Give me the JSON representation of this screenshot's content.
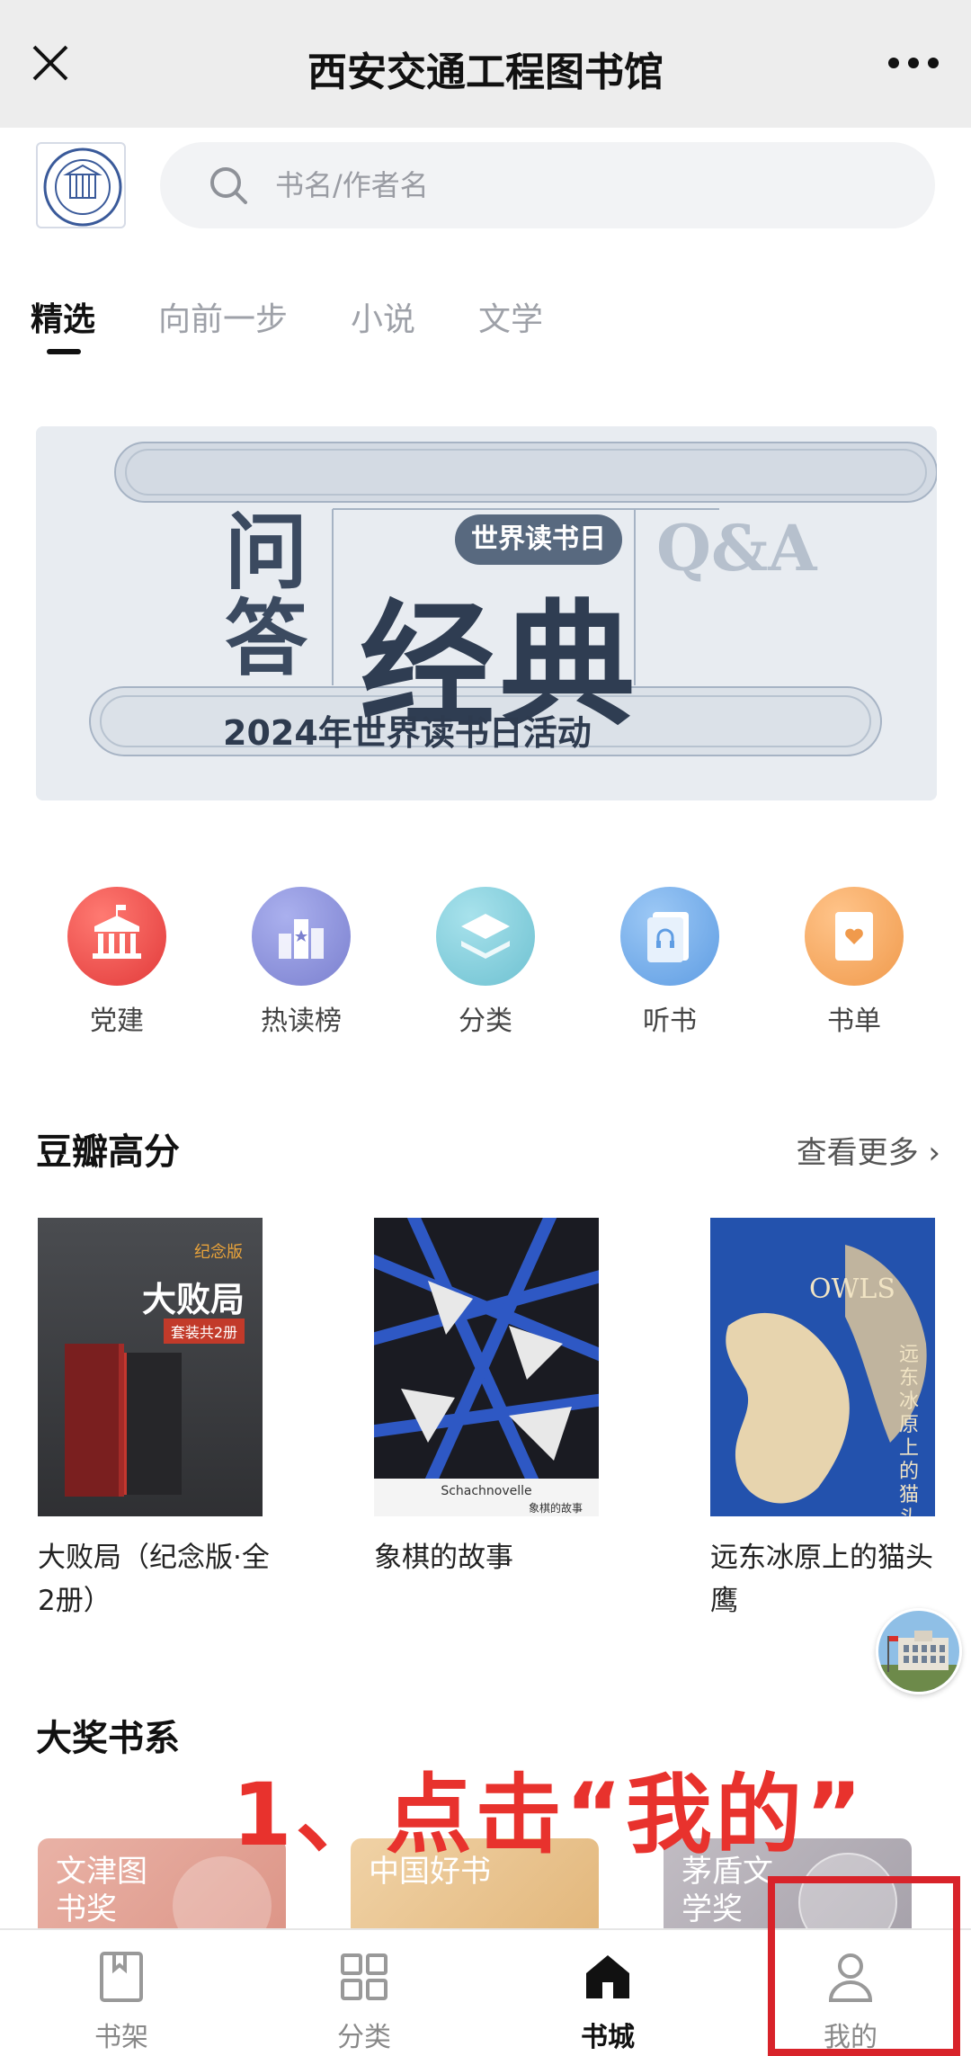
{
  "titlebar": {
    "title": "西安交通工程图书馆",
    "close_icon": "close-icon",
    "more_icon": "more-dots-icon"
  },
  "search": {
    "placeholder": "书名/作者名",
    "icon": "search-icon"
  },
  "tabs": [
    {
      "label": "精选",
      "active": true
    },
    {
      "label": "向前一步",
      "active": false
    },
    {
      "label": "小说",
      "active": false
    },
    {
      "label": "文学",
      "active": false
    }
  ],
  "banner": {
    "badge": "世界读书日",
    "left_text": "问答",
    "main_text": "经典",
    "side_text": "Q&A",
    "subtitle": "2024年世界读书日活动"
  },
  "quick_links": [
    {
      "label": "党建",
      "icon": "building-icon",
      "color": "#e94a4a"
    },
    {
      "label": "热读榜",
      "icon": "ranking-icon",
      "color": "#8a8fd8"
    },
    {
      "label": "分类",
      "icon": "layers-icon",
      "color": "#7dc8d6"
    },
    {
      "label": "听书",
      "icon": "headphone-book-icon",
      "color": "#6fa8e8"
    },
    {
      "label": "书单",
      "icon": "heart-list-icon",
      "color": "#f2a35a"
    }
  ],
  "douban": {
    "title": "豆瓣高分",
    "more": "查看更多",
    "books": [
      {
        "title": "大败局（纪念版·全2册）",
        "cover_title": "大败局",
        "cover_tag": "套装共2册",
        "cover_note": "纪念版"
      },
      {
        "title": "象棋的故事",
        "cover_title": "Schachnovelle",
        "cover_sub": "象棋的故事"
      },
      {
        "title": "远东冰原上的猫头鹰",
        "cover_title": "OWLS",
        "cover_sub": "远东冰原上的猫头鹰"
      }
    ]
  },
  "awards": {
    "title": "大奖书系",
    "items": [
      {
        "label": "文津图书奖",
        "color": "#e5a59a"
      },
      {
        "label": "中国好书",
        "color": "#e8c696"
      },
      {
        "label": "茅盾文学奖",
        "color": "#b4b0b6"
      }
    ]
  },
  "annotation": "1、点击“我的”",
  "bottom_nav": [
    {
      "label": "书架",
      "icon": "bookshelf-icon",
      "active": false
    },
    {
      "label": "分类",
      "icon": "grid-icon",
      "active": false
    },
    {
      "label": "书城",
      "icon": "home-icon",
      "active": true
    },
    {
      "label": "我的",
      "icon": "user-icon",
      "active": false
    }
  ]
}
